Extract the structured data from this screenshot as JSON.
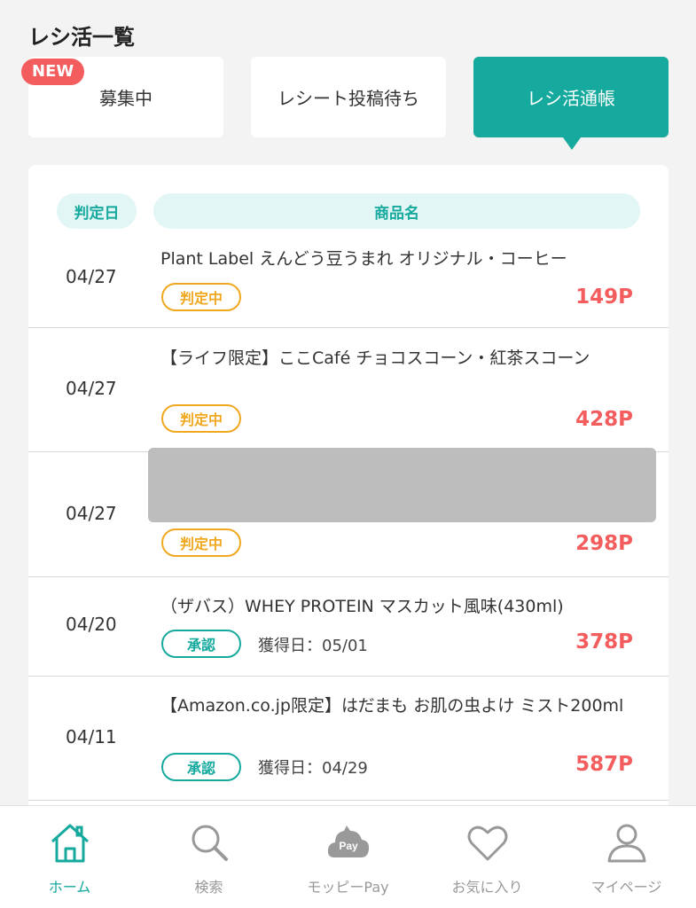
{
  "header": {
    "title": "レシ活一覧"
  },
  "badge": {
    "label": "NEW"
  },
  "tabs": [
    {
      "label": "募集中"
    },
    {
      "label": "レシート投稿待ち"
    },
    {
      "label": "レシ活通帳"
    }
  ],
  "table": {
    "date_header": "判定日",
    "name_header": "商品名",
    "rows": [
      {
        "date": "04/27",
        "name": "Plant Label えんどう豆うまれ オリジナル・コーヒー",
        "status": "判定中",
        "earned": "",
        "points": "149P"
      },
      {
        "date": "04/27",
        "name": "【ライフ限定】ここCafé チョコスコーン・紅茶スコーン",
        "status": "判定中",
        "earned": "",
        "points": "428P"
      },
      {
        "date": "04/27",
        "name": "",
        "status": "判定中",
        "earned": "",
        "points": "298P"
      },
      {
        "date": "04/20",
        "name": "（ザバス）WHEY PROTEIN マスカット風味(430ml)",
        "status": "承認",
        "earned": "獲得日：05/01",
        "points": "378P"
      },
      {
        "date": "04/11",
        "name": "【Amazon.co.jp限定】はだまも お肌の虫よけ ミスト200ml",
        "status": "承認",
        "earned": "獲得日：04/29",
        "points": "587P"
      }
    ]
  },
  "nav": [
    {
      "label": "ホーム",
      "icon": "home-icon"
    },
    {
      "label": "検索",
      "icon": "search-icon"
    },
    {
      "label": "モッピーPay",
      "icon": "pay-cloud-icon",
      "icon_text": "Pay"
    },
    {
      "label": "お気に入り",
      "icon": "heart-icon"
    },
    {
      "label": "マイページ",
      "icon": "person-icon"
    }
  ],
  "colors": {
    "accent": "#16a99e",
    "points": "#f45d5d",
    "judging": "#f0a820"
  }
}
